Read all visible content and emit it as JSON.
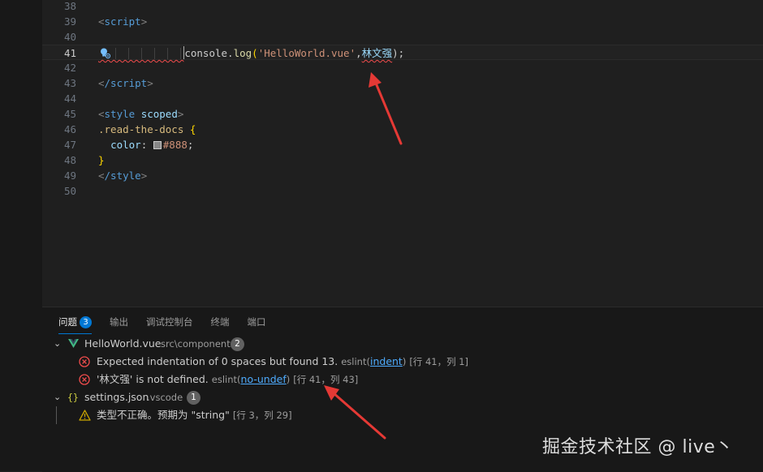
{
  "editor": {
    "lines": [
      {
        "num": "38"
      },
      {
        "num": "39"
      },
      {
        "num": "40"
      },
      {
        "num": "41"
      },
      {
        "num": "42"
      },
      {
        "num": "43"
      },
      {
        "num": "44"
      },
      {
        "num": "45"
      },
      {
        "num": "46"
      },
      {
        "num": "47"
      },
      {
        "num": "48"
      },
      {
        "num": "49"
      },
      {
        "num": "50"
      }
    ],
    "code": {
      "script_open_tag": "script",
      "console": "console.",
      "log": "log",
      "string_arg": "'HelloWorld.vue'",
      "comma": ",",
      "undef_ident": "林文强",
      "close": ");",
      "script_close_tag": "/script",
      "style_tag": "style",
      "style_attr": "scoped",
      "selector": ".read-the-docs",
      "open_brace": "{",
      "prop": "color",
      "colon": ": ",
      "value": "#888",
      "semicolon": ";",
      "close_brace": "}",
      "style_close_tag": "/style"
    }
  },
  "panel": {
    "tabs": [
      {
        "label": "问题",
        "badge": "3"
      },
      {
        "label": "输出"
      },
      {
        "label": "调试控制台"
      },
      {
        "label": "终端"
      },
      {
        "label": "端口"
      }
    ],
    "groups": [
      {
        "file": "HelloWorld.vue",
        "path": "src\\components",
        "count": "2",
        "items": [
          {
            "message": "Expected indentation of 0 spaces but found 13.",
            "source": "eslint",
            "rule": "indent",
            "location": "[行 41，列 1]"
          },
          {
            "message": "'林文强' is not defined.",
            "source": "eslint",
            "rule": "no-undef",
            "location": "[行 41，列 43]"
          }
        ]
      },
      {
        "file": "settings.json",
        "path": ".vscode",
        "count": "1",
        "items": [
          {
            "message": "类型不正确。预期为 \"string\"",
            "location": "[行 3，列 29]"
          }
        ]
      }
    ]
  },
  "watermark": "掘金技术社区 @ live丶",
  "colors": {
    "accent": "#0078d4",
    "error": "#f14c4c",
    "warning": "#cca700",
    "annotation_arrow": "#e53935"
  }
}
